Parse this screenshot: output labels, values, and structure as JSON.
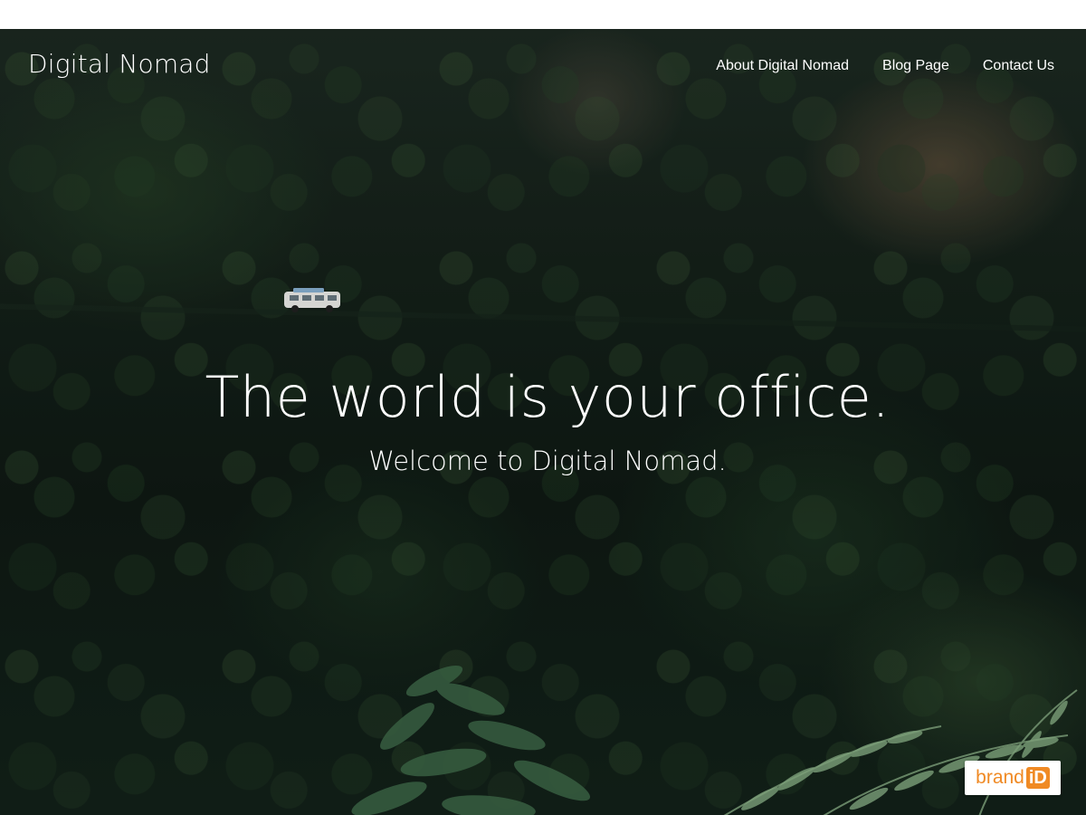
{
  "header": {
    "site_title": "Digital Nomad",
    "nav": [
      {
        "label": "About Digital Nomad"
      },
      {
        "label": "Blog Page"
      },
      {
        "label": "Contact Us"
      }
    ]
  },
  "hero": {
    "headline": "The world is your office.",
    "subheadline": "Welcome to Digital Nomad."
  },
  "badge": {
    "text": "brand",
    "mark": "iD"
  },
  "colors": {
    "text": "#ffffff",
    "badge_accent": "#f08a24",
    "badge_background": "#ffffff"
  },
  "icons": [
    "van-image",
    "fern-foliage",
    "brandid-logo"
  ]
}
